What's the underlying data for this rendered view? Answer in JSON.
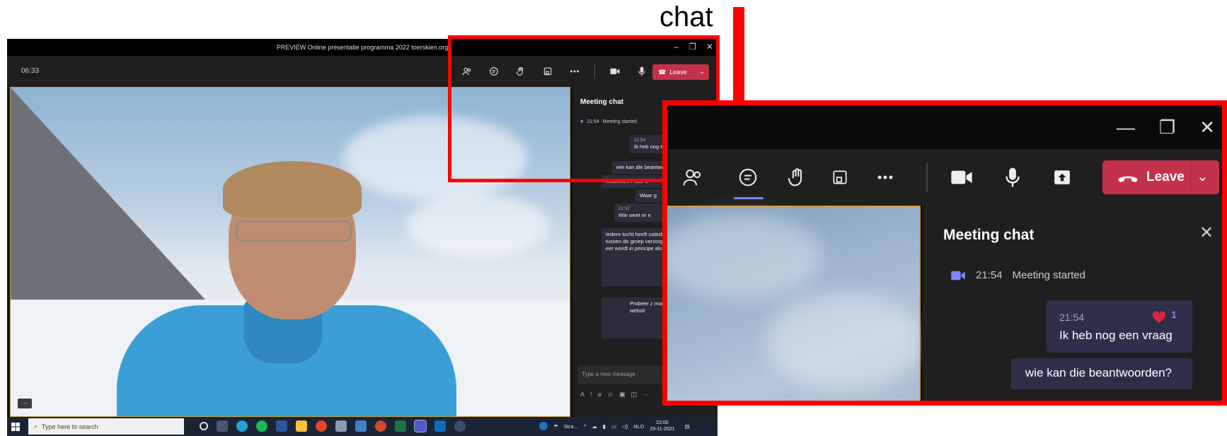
{
  "annotation": {
    "label": "chat"
  },
  "window": {
    "title": "PREVIEW Online presentatie programma 2022 toerskien.org",
    "timer": "06:33",
    "leave_label": "Leave"
  },
  "chat": {
    "title": "Meeting chat",
    "started_time": "21:54",
    "started_text": "Meeting started",
    "messages": [
      {
        "time": "21:54",
        "text": "Ik heb nog een vraag",
        "reactions": 1,
        "reaction_icon": "heart-icon"
      },
      {
        "text": "wie kan die beantwoorden?"
      }
    ],
    "small_messages": [
      "Misschien Peter o",
      "Waar g",
      "Wie weet er e",
      "Iedere tocht heeft coördinator nodig contact tussen de groep verzorgd. D inschrijver van eer wordt in principe als coördinator.",
      "Probeer z mogelijk v de tochte de websit"
    ],
    "small_times": [
      "21:57"
    ],
    "input_placeholder": "Type a new message"
  },
  "taskbar": {
    "search_placeholder": "Type here to search",
    "weather": "Stra...",
    "language": "NLD",
    "time": "22:00",
    "date": "29-11-2021"
  },
  "colors": {
    "leave": "#c4314b",
    "accent": "#7f85f5",
    "highlight": "#ff0000"
  }
}
